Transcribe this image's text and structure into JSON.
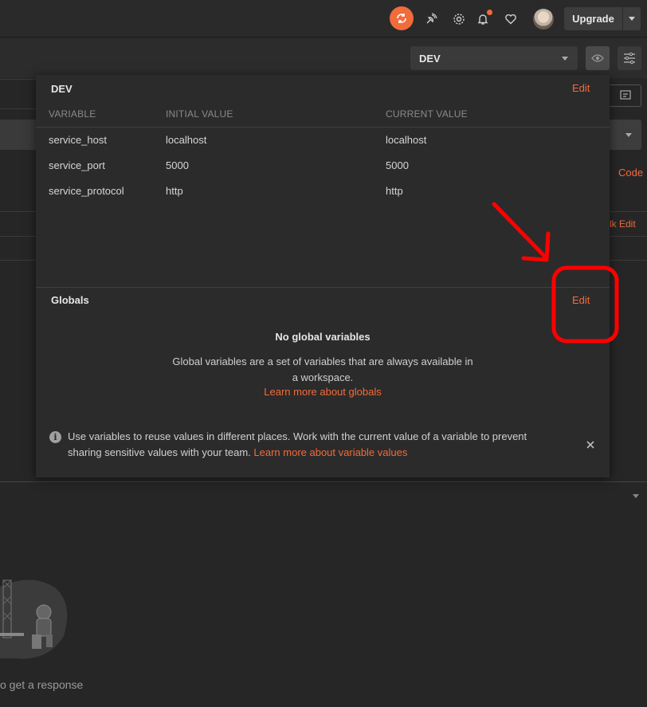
{
  "topbar": {
    "upgrade_label": "Upgrade",
    "icons": [
      "sync-icon",
      "satellite-icon",
      "gear-icon",
      "bell-icon",
      "heart-icon",
      "avatar",
      "chevron-down-icon"
    ]
  },
  "environment_selector": {
    "selected": "DEV"
  },
  "background": {
    "code_link": "Code",
    "bulk_edit_link": "lk Edit",
    "response_hint": "o get a response"
  },
  "panel": {
    "env_name": "DEV",
    "edit_label": "Edit",
    "columns": [
      "VARIABLE",
      "INITIAL VALUE",
      "CURRENT VALUE"
    ],
    "rows": [
      {
        "variable": "service_host",
        "initial": "localhost",
        "current": "localhost"
      },
      {
        "variable": "service_port",
        "initial": "5000",
        "current": "5000"
      },
      {
        "variable": "service_protocol",
        "initial": "http",
        "current": "http"
      }
    ],
    "globals": {
      "title": "Globals",
      "edit_label": "Edit",
      "empty_title": "No global variables",
      "empty_desc": "Global variables are a set of variables that are always available in a workspace.",
      "learn_more": "Learn more about globals"
    },
    "info": {
      "text": "Use variables to reuse values in different places. Work with the current value of a variable to prevent sharing sensitive values with your team.",
      "link": "Learn more about variable values"
    }
  },
  "colors": {
    "accent": "#f26b3a",
    "annotation": "#ff0000",
    "panel_bg": "#2b2b2b",
    "app_bg": "#262626"
  }
}
